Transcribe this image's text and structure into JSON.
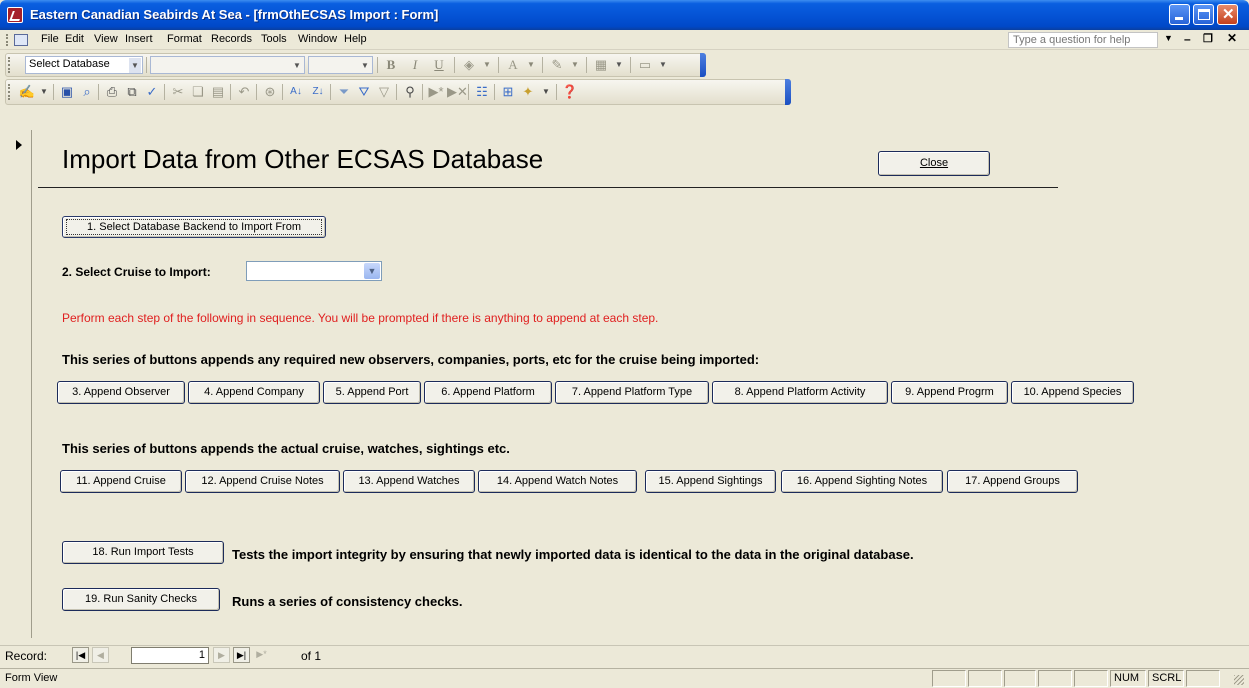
{
  "window": {
    "title": "Eastern Canadian Seabirds At Sea - [frmOthECSAS Import : Form]"
  },
  "menubar": {
    "items": [
      "File",
      "Edit",
      "View",
      "Insert",
      "Format",
      "Records",
      "Tools",
      "Window",
      "Help"
    ],
    "help_placeholder": "Type a question for help"
  },
  "toolbar": {
    "select_database_label": "Select Database",
    "font_combo_value": "",
    "size_combo_value": ""
  },
  "form": {
    "title": "Import Data from Other ECSAS Database",
    "close_label": "Close",
    "select_db_button": "1. Select Database Backend to Import From",
    "select_cruise_label": "2. Select Cruise to Import:",
    "selected_cruise": "",
    "instruction": "Perform each step of the following in sequence. You will be prompted if there is anything to append at each step.",
    "lookup_heading": "This series of buttons appends any required new observers, companies, ports, etc for the cruise being imported:",
    "lookup_buttons": [
      "3. Append Observer",
      "4. Append Company",
      "5. Append Port",
      "6. Append Platform",
      "7. Append Platform Type",
      "8. Append Platform Activity",
      "9. Append Progrm",
      "10. Append Species"
    ],
    "data_heading": "This series of buttons appends the actual cruise, watches, sightings etc.",
    "data_buttons": [
      "11. Append Cruise",
      "12. Append Cruise Notes",
      "13. Append Watches",
      "14. Append Watch Notes",
      "15. Append Sightings",
      "16. Append Sighting Notes",
      "17. Append Groups"
    ],
    "tests_button": "18. Run Import Tests",
    "tests_description": "Tests the import integrity by ensuring that newly imported data is identical to the data in the original database.",
    "sanity_button": "19. Run Sanity Checks",
    "sanity_description": "Runs a series of consistency checks."
  },
  "record_nav": {
    "label": "Record:",
    "current": "1",
    "total_text": "of 1"
  },
  "statusbar": {
    "text": "Form View",
    "num": "NUM",
    "scrl": "SCRL"
  },
  "colors": {
    "instruction_text": "#e02020",
    "titlebar": "#0554d6"
  }
}
